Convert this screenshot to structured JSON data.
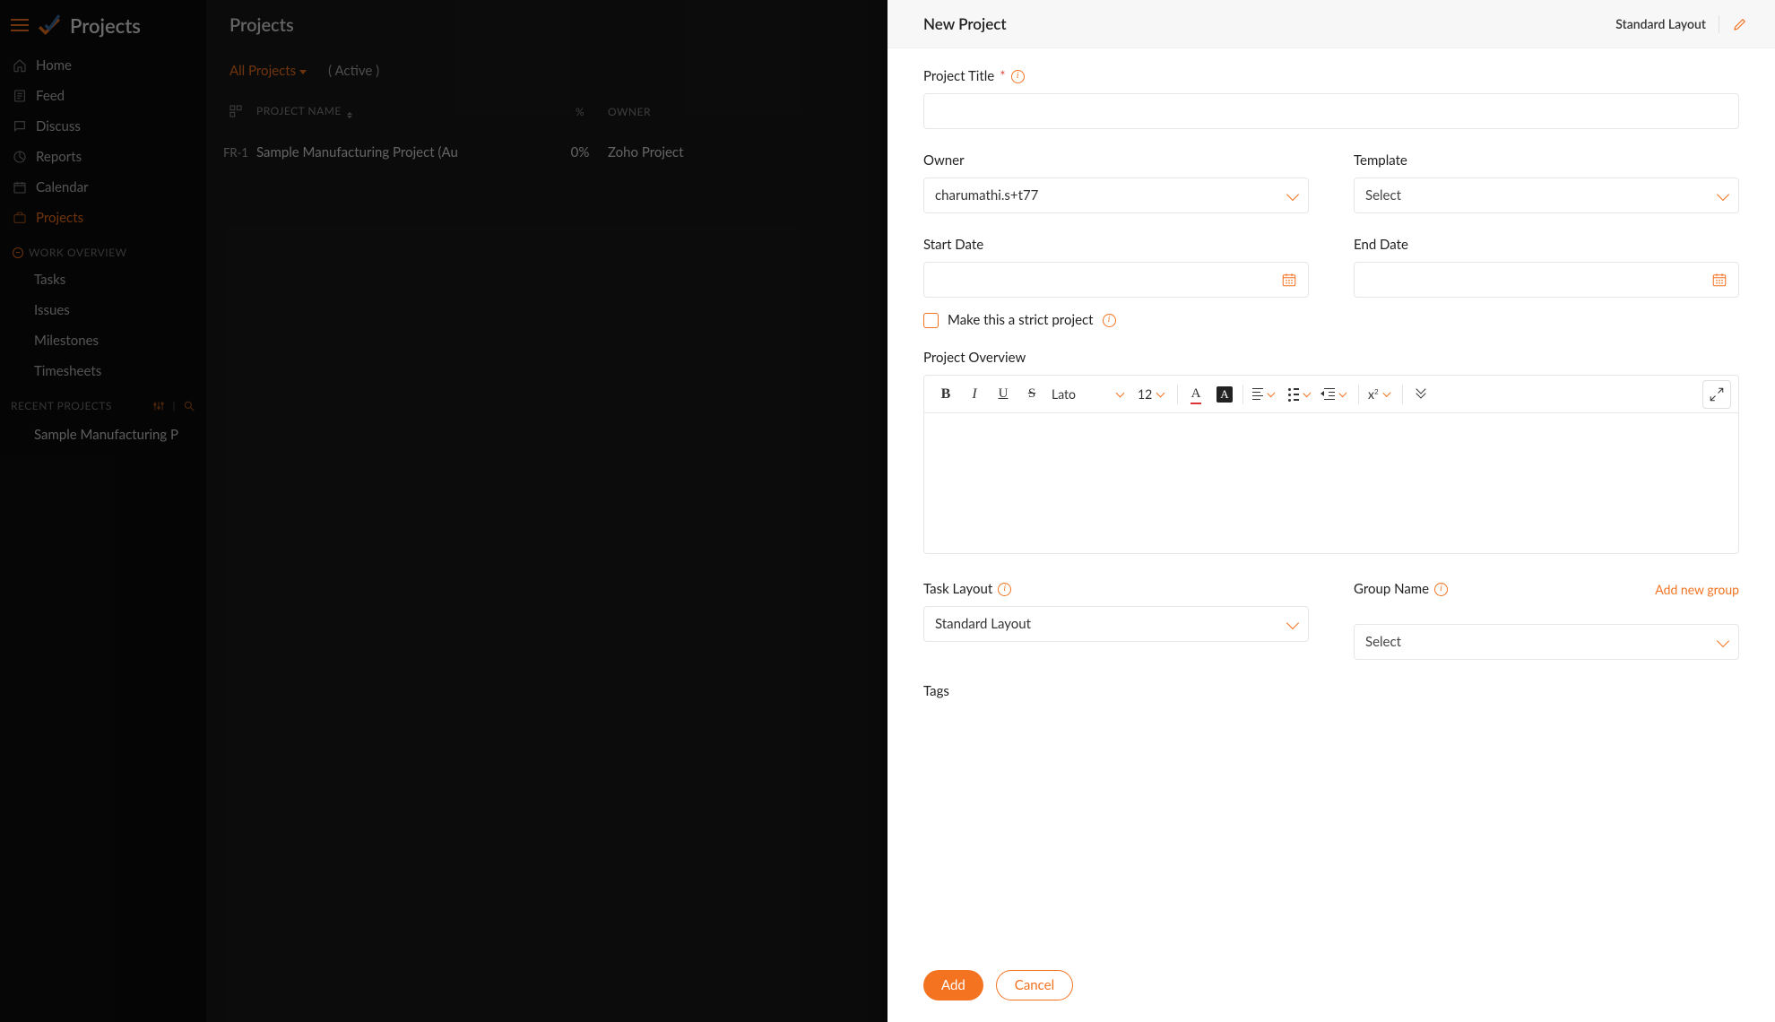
{
  "brand": "Projects",
  "sidebar": {
    "items": [
      {
        "label": "Home"
      },
      {
        "label": "Feed"
      },
      {
        "label": "Discuss"
      },
      {
        "label": "Reports"
      },
      {
        "label": "Calendar"
      },
      {
        "label": "Projects"
      }
    ],
    "overview_label": "WORK OVERVIEW",
    "overview": [
      {
        "label": "Tasks"
      },
      {
        "label": "Issues"
      },
      {
        "label": "Milestones"
      },
      {
        "label": "Timesheets"
      }
    ],
    "recent_label": "RECENT PROJECTS",
    "recent": [
      {
        "label": "Sample Manufacturing P"
      }
    ]
  },
  "main": {
    "title": "Projects",
    "filter_all": "All Projects",
    "filter_active": "( Active )",
    "columns": {
      "name": "PROJECT NAME",
      "pct": "%",
      "owner": "OWNER"
    },
    "row": {
      "id": "FR-1",
      "name": "Sample Manufacturing Project (Au",
      "pct": "0%",
      "owner": "Zoho Project"
    }
  },
  "panel": {
    "title": "New Project",
    "layout_pill": "Standard Layout",
    "fields": {
      "project_title": "Project Title",
      "owner": "Owner",
      "owner_value": "charumathi.s+t77",
      "template": "Template",
      "template_value": "Select",
      "start_date": "Start Date",
      "end_date": "End Date",
      "strict": "Make this a strict project",
      "overview": "Project Overview",
      "task_layout": "Task Layout",
      "task_layout_value": "Standard Layout",
      "group_name": "Group Name",
      "group_name_value": "Select",
      "add_group": "Add new group",
      "tags": "Tags"
    },
    "rte": {
      "font": "Lato",
      "size": "12"
    },
    "buttons": {
      "add": "Add",
      "cancel": "Cancel"
    }
  }
}
